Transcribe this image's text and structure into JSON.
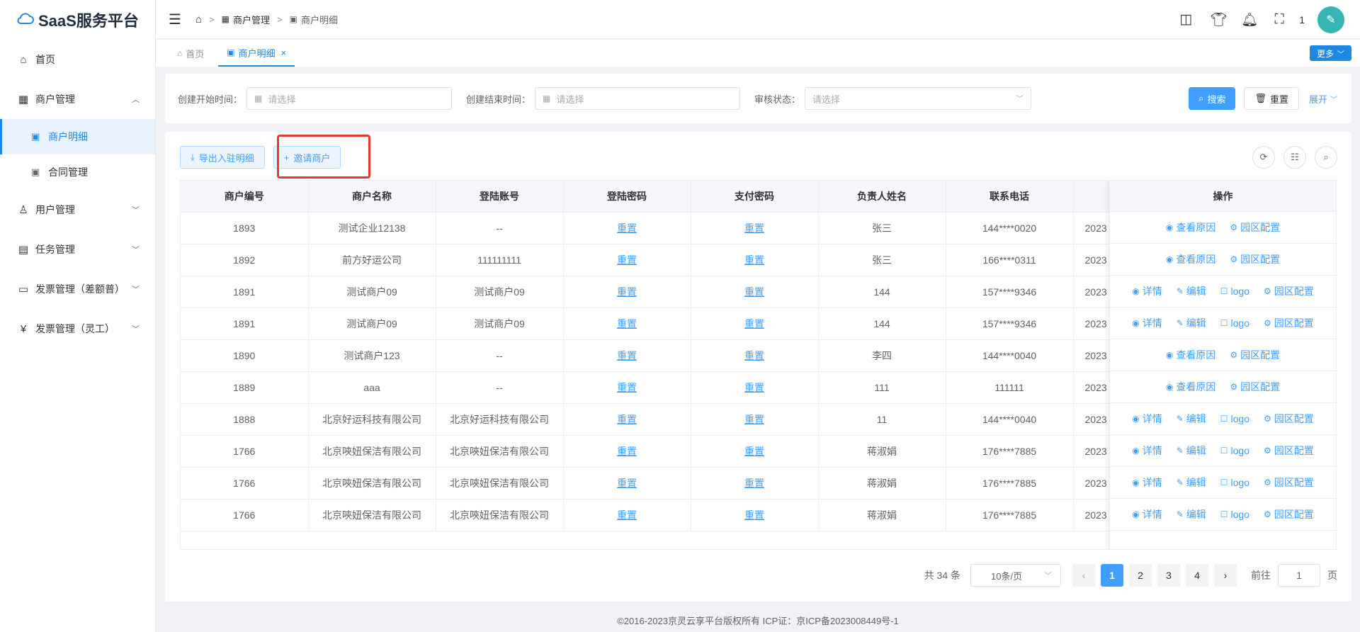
{
  "app": {
    "title": "SaaS服务平台"
  },
  "sidebar": {
    "items": [
      {
        "label": "首页"
      },
      {
        "label": "商户管理"
      },
      {
        "label": "商户明细"
      },
      {
        "label": "合同管理"
      },
      {
        "label": "用户管理"
      },
      {
        "label": "任务管理"
      },
      {
        "label": "发票管理（差额普）"
      },
      {
        "label": "发票管理（灵工）"
      }
    ]
  },
  "header": {
    "breadcrumb": [
      "商户管理",
      "商户明细"
    ],
    "notification_count": "1"
  },
  "tabs": [
    {
      "label": "首页"
    },
    {
      "label": "商户明细"
    }
  ],
  "more_label": "更多",
  "search": {
    "start_label": "创建开始时间：",
    "start_placeholder": "请选择",
    "end_label": "创建结束时间：",
    "end_placeholder": "请选择",
    "status_label": "审核状态：",
    "status_placeholder": "请选择",
    "search_btn": "搜索",
    "reset_btn": "重置",
    "expand_btn": "展开"
  },
  "toolbar": {
    "export_label": "导出入驻明细",
    "invite_label": "邀请商户"
  },
  "table": {
    "columns": [
      "商户编号",
      "商户名称",
      "登陆账号",
      "登陆密码",
      "支付密码",
      "负责人姓名",
      "联系电话",
      "",
      "操作"
    ],
    "rows": [
      {
        "id": "1893",
        "name": "测试企业12138",
        "account": "--",
        "login_pwd": "重置",
        "pay_pwd": "重置",
        "owner": "张三",
        "phone": "144****0020",
        "date": "2023",
        "ops": [
          "查看原因",
          "园区配置"
        ]
      },
      {
        "id": "1892",
        "name": "前方好运公司",
        "account": "111111111",
        "login_pwd": "重置",
        "pay_pwd": "重置",
        "owner": "张三",
        "phone": "166****0311",
        "date": "2023",
        "ops": [
          "查看原因",
          "园区配置"
        ]
      },
      {
        "id": "1891",
        "name": "测试商户09",
        "account": "测试商户09",
        "login_pwd": "重置",
        "pay_pwd": "重置",
        "owner": "144",
        "phone": "157****9346",
        "date": "2023",
        "ops": [
          "详情",
          "编辑",
          "logo",
          "园区配置"
        ]
      },
      {
        "id": "1891",
        "name": "测试商户09",
        "account": "测试商户09",
        "login_pwd": "重置",
        "pay_pwd": "重置",
        "owner": "144",
        "phone": "157****9346",
        "date": "2023",
        "ops": [
          "详情",
          "编辑",
          "logo",
          "园区配置"
        ]
      },
      {
        "id": "1890",
        "name": "测试商户123",
        "account": "--",
        "login_pwd": "重置",
        "pay_pwd": "重置",
        "owner": "李四",
        "phone": "144****0040",
        "date": "2023",
        "ops": [
          "查看原因",
          "园区配置"
        ]
      },
      {
        "id": "1889",
        "name": "aaa",
        "account": "--",
        "login_pwd": "重置",
        "pay_pwd": "重置",
        "owner": "111",
        "phone": "111111",
        "date": "2023",
        "ops": [
          "查看原因",
          "园区配置"
        ]
      },
      {
        "id": "1888",
        "name": "北京好运科技有限公司",
        "account": "北京好运科技有限公司",
        "login_pwd": "重置",
        "pay_pwd": "重置",
        "owner": "11",
        "phone": "144****0040",
        "date": "2023",
        "ops": [
          "详情",
          "编辑",
          "logo",
          "园区配置"
        ]
      },
      {
        "id": "1766",
        "name": "北京唊妞保洁有限公司",
        "account": "北京唊妞保洁有限公司",
        "login_pwd": "重置",
        "pay_pwd": "重置",
        "owner": "蒋淑娟",
        "phone": "176****7885",
        "date": "2023",
        "ops": [
          "详情",
          "编辑",
          "logo",
          "园区配置"
        ]
      },
      {
        "id": "1766",
        "name": "北京唊妞保洁有限公司",
        "account": "北京唊妞保洁有限公司",
        "login_pwd": "重置",
        "pay_pwd": "重置",
        "owner": "蒋淑娟",
        "phone": "176****7885",
        "date": "2023",
        "ops": [
          "详情",
          "编辑",
          "logo",
          "园区配置"
        ]
      },
      {
        "id": "1766",
        "name": "北京唊妞保洁有限公司",
        "account": "北京唊妞保洁有限公司",
        "login_pwd": "重置",
        "pay_pwd": "重置",
        "owner": "蒋淑娟",
        "phone": "176****7885",
        "date": "2023",
        "ops": [
          "详情",
          "编辑",
          "logo",
          "园区配置"
        ]
      }
    ]
  },
  "pagination": {
    "total": "共 34 条",
    "page_size": "10条/页",
    "pages": [
      "1",
      "2",
      "3",
      "4"
    ],
    "current": "1",
    "goto_label": "前往",
    "goto_value": "1",
    "page_suffix": "页"
  },
  "footer": {
    "text": "©2016-2023京灵云享平台版权所有 ICP证：京ICP备2023008449号-1"
  },
  "colors": {
    "primary": "#409eff",
    "highlight": "#e53935"
  },
  "icons": {
    "op_icons": {
      "详情": "eye-icon",
      "查看原因": "eye-icon",
      "编辑": "pen-icon",
      "logo": "edit-square-icon",
      "园区配置": "gear-icon"
    }
  }
}
